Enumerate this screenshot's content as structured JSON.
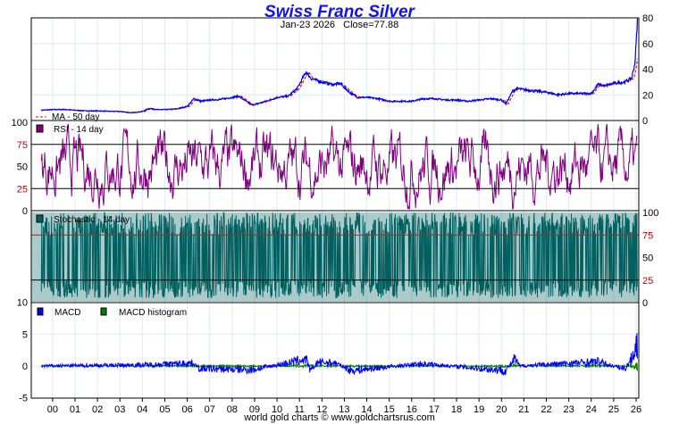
{
  "chart_data": [
    {
      "type": "line",
      "title": "Swiss Franc Silver",
      "subtitle_date": "Jan-23  2026",
      "subtitle_close": "Close=77.88",
      "ylim": [
        0,
        80
      ],
      "yticks": [
        "0",
        "20",
        "40",
        "60",
        "80"
      ],
      "legend": "MA - 50 day",
      "legend_placement": "bottom-left",
      "x": [
        1999.5,
        2000,
        2000.5,
        2001,
        2001.5,
        2002,
        2002.5,
        2003,
        2003.5,
        2004,
        2004.3,
        2004.6,
        2005,
        2005.5,
        2006,
        2006.3,
        2006.6,
        2007,
        2007.5,
        2008,
        2008.3,
        2008.7,
        2008.9,
        2009.5,
        2010,
        2010.5,
        2010.9,
        2011.3,
        2011.5,
        2011.8,
        2012,
        2012.5,
        2012.8,
        2013.3,
        2013.6,
        2014,
        2014.5,
        2015,
        2015.5,
        2016,
        2016.5,
        2017,
        2017.5,
        2018,
        2018.5,
        2019,
        2019.5,
        2020,
        2020.2,
        2020.5,
        2020.7,
        2021,
        2021.5,
        2022,
        2022.5,
        2023,
        2023.5,
        2024,
        2024.3,
        2024.6,
        2025,
        2025.5,
        2025.8,
        2025.95,
        2026.06
      ],
      "series": [
        {
          "name": "Close",
          "color": "#0000ff",
          "values": [
            8,
            8.5,
            8.6,
            8,
            7.5,
            7.5,
            7.2,
            7,
            6,
            7,
            9.5,
            8.5,
            8.5,
            9,
            11,
            17,
            15,
            16,
            16.5,
            18,
            19,
            14,
            12,
            15,
            18,
            19,
            25,
            38,
            33,
            31,
            30,
            28,
            29,
            21,
            18,
            18,
            17,
            15,
            15,
            15,
            17,
            17,
            16,
            16,
            15,
            16,
            17,
            16,
            13,
            23,
            25,
            24,
            23,
            22,
            20,
            21,
            21,
            21,
            28,
            27,
            29,
            30,
            33,
            45,
            77.88
          ]
        }
      ]
    },
    {
      "type": "line",
      "title": "RSI - 14 day",
      "ylim": [
        0,
        100
      ],
      "yticks": [
        "0",
        "25",
        "50",
        "75",
        "100"
      ],
      "reference_lines": [
        25,
        75
      ],
      "color": "#800080"
    },
    {
      "type": "line",
      "title": "Stochastic - 14 day",
      "ylim": [
        0,
        100
      ],
      "yticks": [
        "0",
        "25",
        "50",
        "75",
        "100"
      ],
      "reference_lines": [
        25,
        75
      ],
      "color": "#006060"
    },
    {
      "type": "line",
      "title": "MACD",
      "ylim": [
        -5,
        10
      ],
      "yticks": [
        "-5",
        "0",
        "5",
        "10"
      ],
      "legend": [
        "MACD",
        "MACD histogram"
      ],
      "colors": {
        "macd": "#0000ff",
        "hist": "#008000"
      },
      "x": [
        1999.5,
        2004.2,
        2006.3,
        2006.5,
        2008.9,
        2010.9,
        2011.3,
        2011.5,
        2011.8,
        2012.6,
        2013.3,
        2016.5,
        2020.2,
        2020.6,
        2020.8,
        2024.3,
        2025.5,
        2025.8,
        2026.06
      ],
      "values": [
        0,
        0.3,
        0.8,
        -0.7,
        -1,
        1.3,
        1.8,
        -1.5,
        1,
        0.8,
        -1.2,
        0.6,
        -1.2,
        1.9,
        0,
        1.1,
        -0.8,
        2,
        6.2
      ]
    }
  ],
  "xticks": [
    "00",
    "01",
    "02",
    "03",
    "04",
    "05",
    "06",
    "07",
    "08",
    "09",
    "10",
    "11",
    "12",
    "13",
    "14",
    "15",
    "16",
    "17",
    "18",
    "19",
    "20",
    "21",
    "22",
    "23",
    "24",
    "25",
    "26"
  ],
  "footer": "world gold charts © www.goldchartsrus.com"
}
